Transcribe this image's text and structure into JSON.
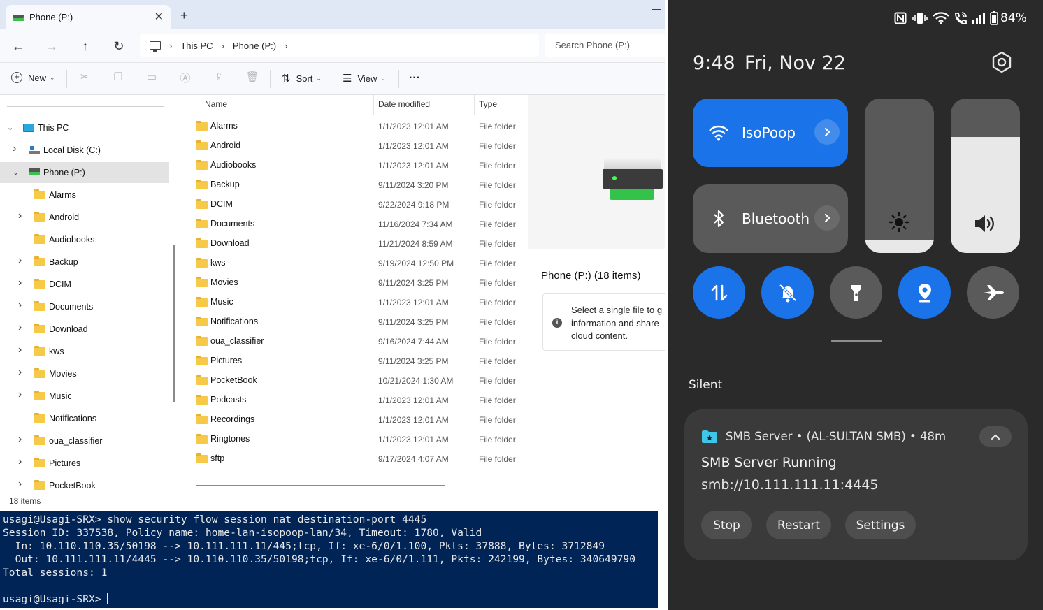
{
  "explorer": {
    "tab_title": "Phone (P:)",
    "tab_close": "✕",
    "new_tab": "+",
    "minimize": "—",
    "nav": {
      "back": "←",
      "forward": "→",
      "up": "↑",
      "refresh": "↻"
    },
    "breadcrumbs": [
      "This PC",
      "Phone (P:)"
    ],
    "crumb_sep": "›",
    "search_placeholder": "Search Phone (P:)",
    "toolbar": {
      "new_label": "New",
      "sort_label": "Sort",
      "view_label": "View",
      "more_label": "···",
      "chevron": "⌄"
    },
    "tree": [
      {
        "label": "This PC",
        "icon": "pc-icon",
        "level": 0,
        "expanded": true
      },
      {
        "label": "Local Disk (C:)",
        "icon": "disk-icon",
        "level": 1,
        "expandable": true
      },
      {
        "label": "Phone (P:)",
        "icon": "phone-drive-icon",
        "level": 1,
        "expanded": true,
        "selected": true
      },
      {
        "label": "Alarms",
        "icon": "folder-icon",
        "level": 2,
        "expandable": false
      },
      {
        "label": "Android",
        "icon": "folder-icon",
        "level": 2,
        "expandable": true
      },
      {
        "label": "Audiobooks",
        "icon": "folder-icon",
        "level": 2,
        "expandable": false
      },
      {
        "label": "Backup",
        "icon": "folder-icon",
        "level": 2,
        "expandable": true
      },
      {
        "label": "DCIM",
        "icon": "folder-icon",
        "level": 2,
        "expandable": true
      },
      {
        "label": "Documents",
        "icon": "folder-icon",
        "level": 2,
        "expandable": true
      },
      {
        "label": "Download",
        "icon": "folder-icon",
        "level": 2,
        "expandable": true
      },
      {
        "label": "kws",
        "icon": "folder-icon",
        "level": 2,
        "expandable": true
      },
      {
        "label": "Movies",
        "icon": "folder-icon",
        "level": 2,
        "expandable": true
      },
      {
        "label": "Music",
        "icon": "folder-icon",
        "level": 2,
        "expandable": true
      },
      {
        "label": "Notifications",
        "icon": "folder-icon",
        "level": 2,
        "expandable": false
      },
      {
        "label": "oua_classifier",
        "icon": "folder-icon",
        "level": 2,
        "expandable": true
      },
      {
        "label": "Pictures",
        "icon": "folder-icon",
        "level": 2,
        "expandable": true
      },
      {
        "label": "PocketBook",
        "icon": "folder-icon",
        "level": 2,
        "expandable": true
      }
    ],
    "columns": {
      "name": "Name",
      "date": "Date modified",
      "type": "Type"
    },
    "files": [
      {
        "name": "Alarms",
        "date": "1/1/2023 12:01 AM",
        "type": "File folder"
      },
      {
        "name": "Android",
        "date": "1/1/2023 12:01 AM",
        "type": "File folder"
      },
      {
        "name": "Audiobooks",
        "date": "1/1/2023 12:01 AM",
        "type": "File folder"
      },
      {
        "name": "Backup",
        "date": "9/11/2024 3:20 PM",
        "type": "File folder"
      },
      {
        "name": "DCIM",
        "date": "9/22/2024 9:18 PM",
        "type": "File folder"
      },
      {
        "name": "Documents",
        "date": "11/16/2024 7:34 AM",
        "type": "File folder"
      },
      {
        "name": "Download",
        "date": "11/21/2024 8:59 AM",
        "type": "File folder"
      },
      {
        "name": "kws",
        "date": "9/19/2024 12:50 PM",
        "type": "File folder"
      },
      {
        "name": "Movies",
        "date": "9/11/2024 3:25 PM",
        "type": "File folder"
      },
      {
        "name": "Music",
        "date": "1/1/2023 12:01 AM",
        "type": "File folder"
      },
      {
        "name": "Notifications",
        "date": "9/11/2024 3:25 PM",
        "type": "File folder"
      },
      {
        "name": "oua_classifier",
        "date": "9/16/2024 7:44 AM",
        "type": "File folder"
      },
      {
        "name": "Pictures",
        "date": "9/11/2024 3:25 PM",
        "type": "File folder"
      },
      {
        "name": "PocketBook",
        "date": "10/21/2024 1:30 AM",
        "type": "File folder"
      },
      {
        "name": "Podcasts",
        "date": "1/1/2023 12:01 AM",
        "type": "File folder"
      },
      {
        "name": "Recordings",
        "date": "1/1/2023 12:01 AM",
        "type": "File folder"
      },
      {
        "name": "Ringtones",
        "date": "1/1/2023 12:01 AM",
        "type": "File folder"
      },
      {
        "name": "sftp",
        "date": "9/17/2024 4:07 AM",
        "type": "File folder"
      }
    ],
    "details": {
      "title": "Phone (P:) (18 items)",
      "info_lines": [
        "Select a single file to g",
        "information and share",
        "cloud content."
      ]
    },
    "status": "18 items"
  },
  "terminal": {
    "lines": [
      "usagi@Usagi-SRX> show security flow session nat destination-port 4445",
      "Session ID: 337538, Policy name: home-lan-isopoop-lan/34, Timeout: 1780, Valid",
      "  In: 10.110.110.35/50198 --> 10.111.111.11/445;tcp, If: xe-6/0/1.100, Pkts: 37888, Bytes: 3712849",
      "  Out: 10.111.111.11/4445 --> 10.110.110.35/50198;tcp, If: xe-6/0/1.111, Pkts: 242199, Bytes: 340649790",
      "Total sessions: 1",
      ""
    ],
    "prompt": "usagi@Usagi-SRX> "
  },
  "android": {
    "battery": "84%",
    "time": "9:48",
    "date": "Fri, Nov 22",
    "wifi_tile": {
      "label": "IsoPoop",
      "active": true
    },
    "bluetooth_tile": {
      "label": "Bluetooth",
      "active": false
    },
    "brightness_level": 0.08,
    "volume_level": 0.75,
    "round_toggles": [
      {
        "name": "mobile-data-icon",
        "active": true
      },
      {
        "name": "mute-icon",
        "active": true
      },
      {
        "name": "flashlight-icon",
        "active": false
      },
      {
        "name": "location-icon",
        "active": true
      },
      {
        "name": "airplane-icon",
        "active": false
      }
    ],
    "section": "Silent",
    "notification": {
      "header": "SMB Server • (AL-SULTAN SMB) • 48m",
      "title": "SMB Server Running",
      "body": "smb://10.111.111.11:4445",
      "actions": [
        "Stop",
        "Restart",
        "Settings"
      ]
    },
    "colors": {
      "accent": "#1a73e8",
      "inactive": "#5a5a5a",
      "background": "#2a2a2a"
    }
  }
}
